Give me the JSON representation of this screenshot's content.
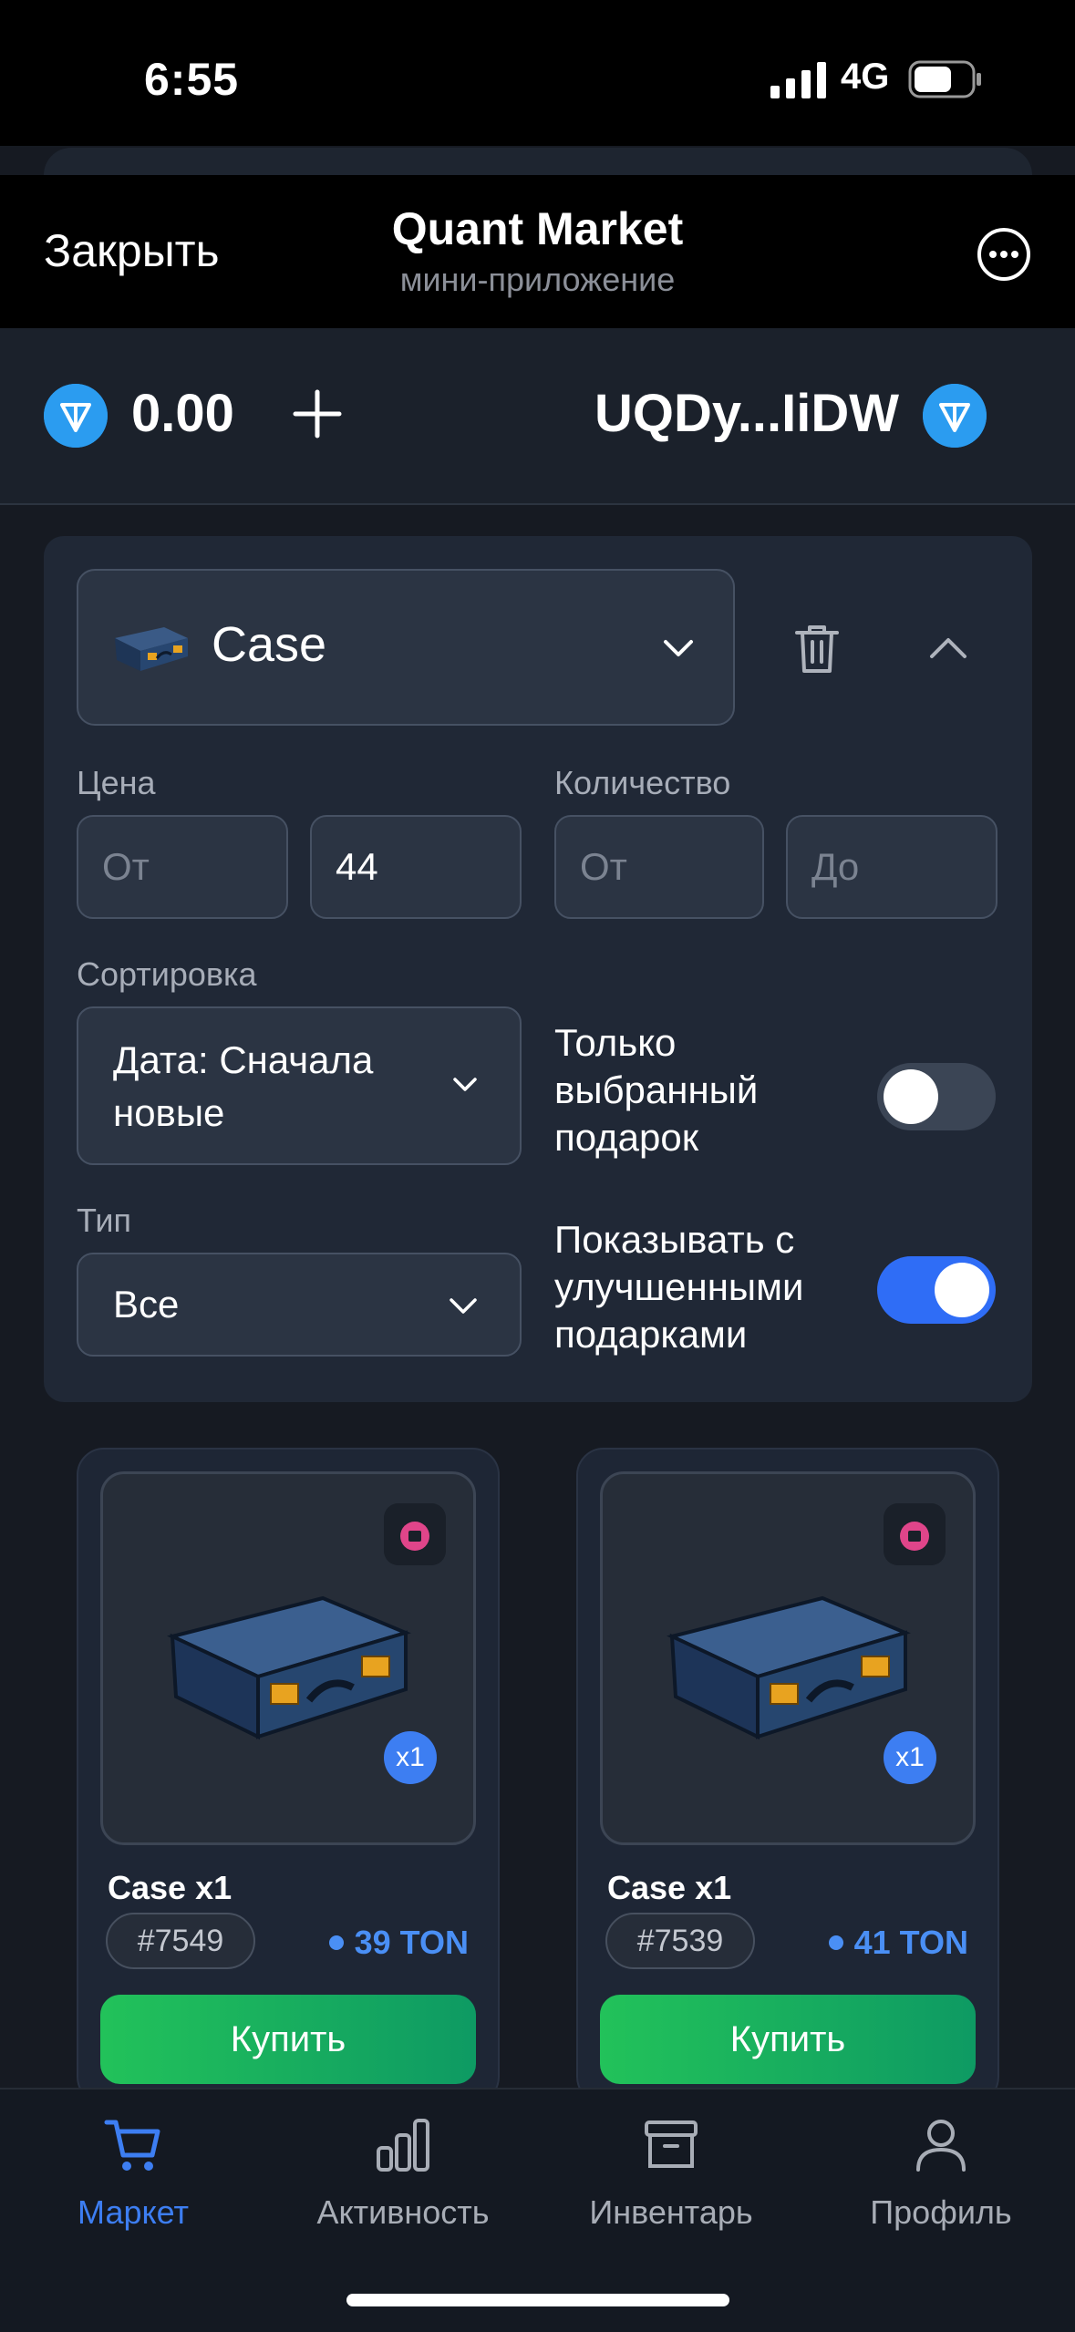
{
  "status_bar": {
    "time": "6:55",
    "network": "4G"
  },
  "header": {
    "close_label": "Закрыть",
    "title": "Quant Market",
    "subtitle": "мини-приложение"
  },
  "balance": {
    "amount": "0.00",
    "wallet": "UQDy...IiDW"
  },
  "filters": {
    "gift": "Case",
    "price_label": "Цена",
    "price_from_placeholder": "От",
    "price_to_value": "44",
    "quantity_label": "Количество",
    "qty_from_placeholder": "От",
    "qty_to_placeholder": "До",
    "sort_label": "Сортировка",
    "sort_value": "Дата: Сначала новые",
    "only_selected_label": "Только выбранный подарок",
    "only_selected_on": false,
    "type_label": "Тип",
    "type_value": "Все",
    "show_upgraded_label": "Показывать с улучшенными подарками",
    "show_upgraded_on": true
  },
  "cards": [
    {
      "name": "Case x1",
      "id": "#7549",
      "price": "39 TON",
      "qty": "x1",
      "buy": "Купить"
    },
    {
      "name": "Case x1",
      "id": "#7539",
      "price": "41 TON",
      "qty": "x1",
      "buy": "Купить"
    }
  ],
  "nav": [
    {
      "label": "Маркет",
      "icon": "cart-icon",
      "active": true
    },
    {
      "label": "Активность",
      "icon": "chart-icon",
      "active": false
    },
    {
      "label": "Инвентарь",
      "icon": "archive-icon",
      "active": false
    },
    {
      "label": "Профиль",
      "icon": "user-icon",
      "active": false
    }
  ],
  "colors": {
    "accent": "#3d7ef2",
    "buy_start": "#22c25a",
    "buy_end": "#0e9a63",
    "ton": "#2b9cf0"
  }
}
